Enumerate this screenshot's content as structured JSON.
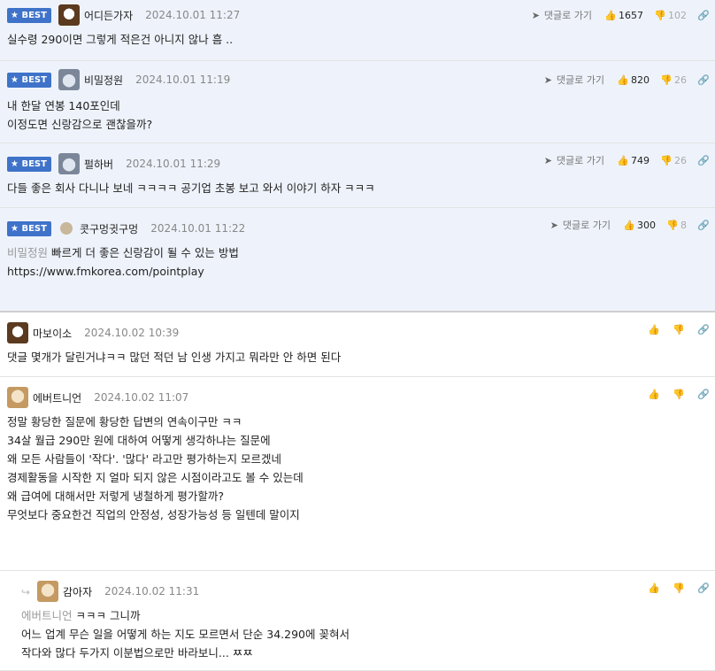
{
  "badge": "BEST",
  "reply_label": "댓글로 가기",
  "best_comments": [
    {
      "nick": "어디든가자",
      "date": "2024.10.01 11:27",
      "up": "1657",
      "down": "102",
      "lines": [
        "실수령 290이면 그렇게 적은건 아니지 않나 흠 .."
      ]
    },
    {
      "nick": "비밀정원",
      "date": "2024.10.01 11:19",
      "up": "820",
      "down": "26",
      "lines": [
        "내 한달 연봉 140포인데",
        "이정도면 신랑감으로 괜찮을까?"
      ]
    },
    {
      "nick": "펄하버",
      "date": "2024.10.01 11:29",
      "up": "749",
      "down": "26",
      "lines": [
        "다들 좋은 회사 다니나 보네 ㅋㅋㅋㅋ 공기업 초봉 보고 와서 이야기 하자 ㅋㅋㅋ"
      ]
    },
    {
      "nick": "콧구멍귓구멍",
      "date": "2024.10.01 11:22",
      "up": "300",
      "down": "8",
      "mention": "비밀정원",
      "lines": [
        "빠르게 더 좋은 신랑감이 될 수 있는 방법",
        "",
        "https://www.fmkorea.com/pointplay"
      ]
    }
  ],
  "comments": [
    {
      "nick": "마보이소",
      "date": "2024.10.02 10:39",
      "lines": [
        "댓글 몇개가 달린거냐ㅋㅋ 많던 적던 남 인생 가지고 뭐라만 안 하면 된다"
      ]
    },
    {
      "nick": "에버트니언",
      "date": "2024.10.02 11:07",
      "lines": [
        "정말 황당한 질문에 황당한 답변의 연속이구만 ㅋㅋ",
        "34살 월급 290만 원에 대하여 어떻게 생각하냐는 질문에",
        "왜 모든 사람들이 '작다'. '많다' 라고만 평가하는지 모르겠네",
        "",
        "경제활동을 시작한 지 얼마 되지 않은 시점이라고도 볼 수 있는데",
        "왜 급여에 대해서만 저렇게 냉철하게 평가할까?",
        "",
        "무엇보다 중요한건 직업의 안정성, 성장가능성 등 일텐데 말이지"
      ]
    },
    {
      "nick": "감아자",
      "date": "2024.10.02 11:31",
      "mention": "에버트니언",
      "lines": [
        "ㅋㅋㅋ 그니까",
        "어느 업계 무슨 일을 어떻게 하는 지도 모르면서 단순 34.290에 꽂혀서",
        "작다와 많다 두가지 이분법으로만 바라보니... ㅉㅉ"
      ]
    }
  ]
}
